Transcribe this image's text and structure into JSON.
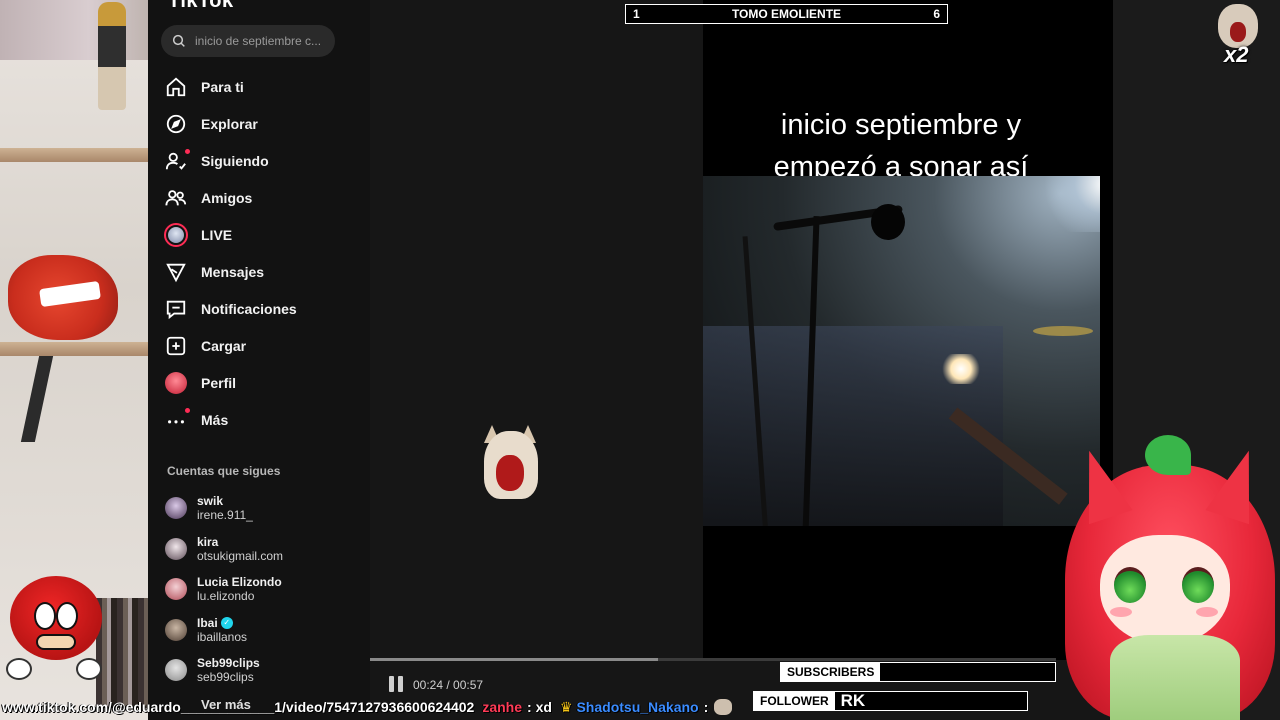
{
  "app": {
    "logo": "TikTok"
  },
  "search": {
    "placeholder": "inicio de septiembre c..."
  },
  "nav": [
    {
      "label": "Para ti",
      "icon": "home-icon"
    },
    {
      "label": "Explorar",
      "icon": "compass-icon"
    },
    {
      "label": "Siguiendo",
      "icon": "user-following-icon"
    },
    {
      "label": "Amigos",
      "icon": "friends-icon"
    },
    {
      "label": "LIVE",
      "icon": "live-icon"
    },
    {
      "label": "Mensajes",
      "icon": "paper-plane-icon"
    },
    {
      "label": "Notificaciones",
      "icon": "inbox-icon"
    },
    {
      "label": "Cargar",
      "icon": "upload-plus-icon"
    },
    {
      "label": "Perfil",
      "icon": "profile-avatar"
    },
    {
      "label": "Más",
      "icon": "more-dots-icon"
    }
  ],
  "following": {
    "title": "Cuentas que sigues",
    "accounts": [
      {
        "name": "swik",
        "handle": "irene.911_",
        "verified": false
      },
      {
        "name": "kira",
        "handle": "otsukigmail.com",
        "verified": false
      },
      {
        "name": "Lucia Elizondo",
        "handle": "lu.elizondo",
        "verified": false
      },
      {
        "name": "Ibai",
        "handle": "ibaillanos",
        "verified": true
      },
      {
        "name": "Seb99clips",
        "handle": "seb99clips",
        "verified": false
      }
    ],
    "see_more": "Ver más"
  },
  "video": {
    "caption_line1": "inicio septiembre y",
    "caption_line2": "empezó a sonar así",
    "time": "00:24 / 00:57",
    "progress": 0.42
  },
  "overlay": {
    "goal_left": "1",
    "goal_title": "TOMO EMOLIENTE",
    "goal_right": "6",
    "subs_label": "SUBSCRIBERS",
    "subs_value": "",
    "follower_label": "FOLLOWER",
    "follower_value": "RK",
    "multiplier": "x2"
  },
  "ticker": {
    "url": "www.tiktok.com/@eduardo____________1/video/7547127936600624402",
    "user1": "zanhe",
    "msg1": ": xd",
    "user2": "Shadotsu_Nakano",
    "msg2": ":"
  },
  "colors": {
    "accent": "#fe2c55",
    "verified": "#20d5ec"
  }
}
